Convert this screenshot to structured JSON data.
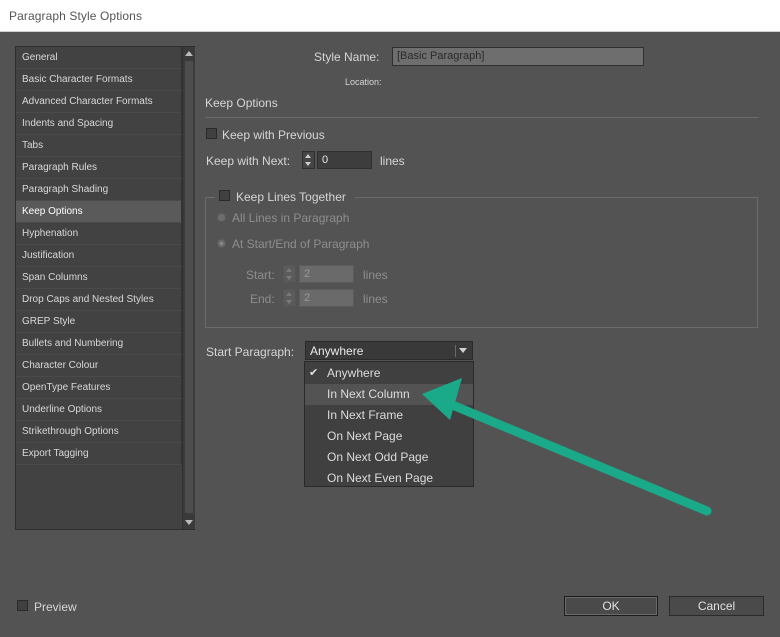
{
  "window": {
    "title": "Paragraph Style Options"
  },
  "sidebar": {
    "items": [
      {
        "label": "General"
      },
      {
        "label": "Basic Character Formats"
      },
      {
        "label": "Advanced Character Formats"
      },
      {
        "label": "Indents and Spacing"
      },
      {
        "label": "Tabs"
      },
      {
        "label": "Paragraph Rules"
      },
      {
        "label": "Paragraph Shading"
      },
      {
        "label": "Keep Options",
        "selected": true
      },
      {
        "label": "Hyphenation"
      },
      {
        "label": "Justification"
      },
      {
        "label": "Span Columns"
      },
      {
        "label": "Drop Caps and Nested Styles"
      },
      {
        "label": "GREP Style"
      },
      {
        "label": "Bullets and Numbering"
      },
      {
        "label": "Character Colour"
      },
      {
        "label": "OpenType Features"
      },
      {
        "label": "Underline Options"
      },
      {
        "label": "Strikethrough Options"
      },
      {
        "label": "Export Tagging"
      }
    ]
  },
  "main": {
    "style_name_label": "Style Name:",
    "style_name_value": "[Basic Paragraph]",
    "location_label": "Location:",
    "section_title": "Keep Options",
    "keep_with_previous_label": "Keep with Previous",
    "keep_with_next_label": "Keep with Next:",
    "keep_with_next_value": "0",
    "keep_with_next_unit": "lines",
    "keep_lines_together_label": "Keep Lines Together",
    "all_lines_label": "All Lines in Paragraph",
    "at_start_end_label": "At Start/End of Paragraph",
    "start_label": "Start:",
    "start_value": "2",
    "start_unit": "lines",
    "end_label": "End:",
    "end_value": "2",
    "end_unit": "lines",
    "start_paragraph_label": "Start Paragraph:",
    "start_paragraph_value": "Anywhere",
    "start_paragraph_options": [
      {
        "label": "Anywhere",
        "checked": true
      },
      {
        "label": "In Next Column",
        "highlighted": true
      },
      {
        "label": "In Next Frame"
      },
      {
        "label": "On Next Page"
      },
      {
        "label": "On Next Odd Page"
      },
      {
        "label": "On Next Even Page"
      }
    ]
  },
  "footer": {
    "preview_label": "Preview",
    "ok_label": "OK",
    "cancel_label": "Cancel"
  },
  "annotation": {
    "arrow_color": "#1aaa8a"
  }
}
